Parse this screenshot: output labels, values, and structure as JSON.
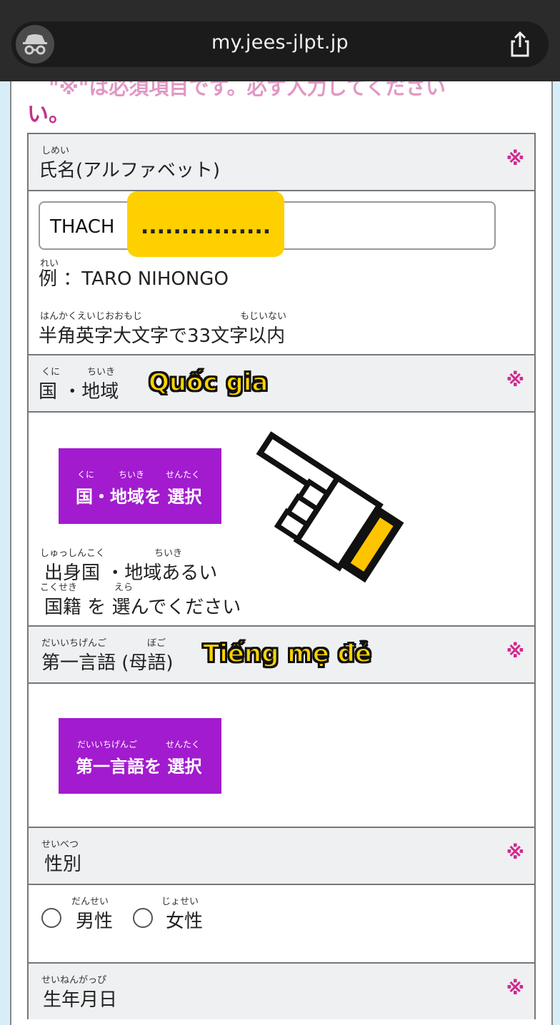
{
  "browser": {
    "url": "my.jees-jlpt.jp",
    "incognito_icon": "incognito-icon",
    "share_icon": "share-icon"
  },
  "notice": {
    "line1_partial": "\"※\"は必須項目です。必ず入力してください",
    "line2": "い。"
  },
  "required_mark": "※",
  "fields": {
    "name": {
      "ruby": "しめい",
      "label": "氏名(アルファベット)",
      "value": "THACH",
      "masked": "................",
      "example_ruby": "れい",
      "example": "例 ：TARO NIHONGO",
      "rule_ruby_1": "はんかくえいじおおもじ",
      "rule_ruby_2": "もじいない",
      "rule": "半角英字大文字で33文字以内"
    },
    "country": {
      "ruby_1": "くに",
      "ruby_2": "ちいき",
      "label": "国 ・地域",
      "caption": "Quốc gia",
      "button_ruby_1": "くに",
      "button_ruby_2": "ちいき",
      "button_ruby_3": "せんたく",
      "button": "国・地域を 選択",
      "hint_ruby_1": "しゅっしんこく",
      "hint_ruby_2": "ちいき",
      "hint_line1": "出身国 ・地域あるい",
      "hint_ruby_3": "こくせき",
      "hint_ruby_4": "えら",
      "hint_line2": "国籍 を 選んでください"
    },
    "language": {
      "ruby_1": "だいいちげんご",
      "ruby_2": "ぼご",
      "label": "第一言語 (母語)",
      "caption": "Tiếng mẹ đẻ",
      "button_ruby_1": "だいいちげんご",
      "button_ruby_2": "せんたく",
      "button": "第一言語を 選択"
    },
    "gender": {
      "ruby": "せいべつ",
      "label": "性別",
      "male_ruby": "だんせい",
      "male": "男性",
      "female_ruby": "じょせい",
      "female": "女性"
    },
    "birthdate": {
      "ruby": "せいねんがっぴ",
      "label": "生年月日"
    }
  },
  "overlay": {
    "hand_icon": "pointing-hand-icon"
  }
}
